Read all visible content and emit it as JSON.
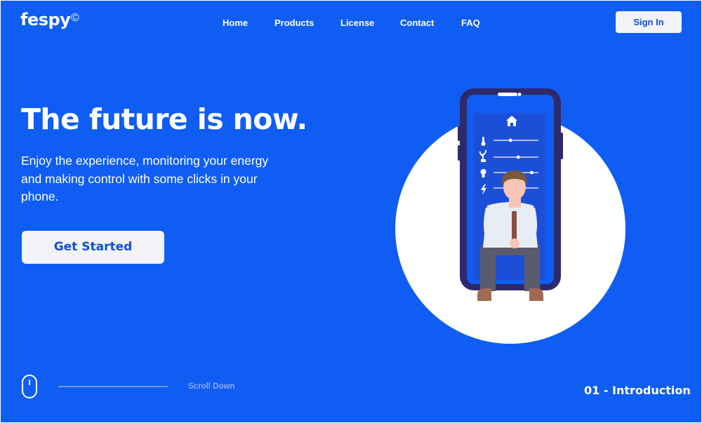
{
  "brand": {
    "name": "fespy",
    "mark": "©"
  },
  "nav": {
    "items": [
      {
        "label": "Home"
      },
      {
        "label": "Products"
      },
      {
        "label": "License"
      },
      {
        "label": "Contact"
      },
      {
        "label": "FAQ"
      }
    ],
    "signin_label": "Sign In"
  },
  "hero": {
    "headline": "The future is now.",
    "lead": "Enjoy the experience, monitoring your energy and making control with some clicks in your phone.",
    "cta_label": "Get Started"
  },
  "footer": {
    "scroll_label": "Scroll Down",
    "section_label": "01 - Introduction"
  },
  "phone_app": {
    "icons": [
      "home-icon",
      "thermometer-icon",
      "plant-icon",
      "bulb-icon",
      "lightning-icon"
    ],
    "slider_levels": [
      0.38,
      0.55,
      0.85,
      0.3
    ]
  },
  "colors": {
    "background": "#0f5df3",
    "accent_text": "#0f4fd8",
    "button_bg": "#f2f3f7",
    "phone_body": "#2d2a6b",
    "phone_screen": "#0f5df3"
  }
}
